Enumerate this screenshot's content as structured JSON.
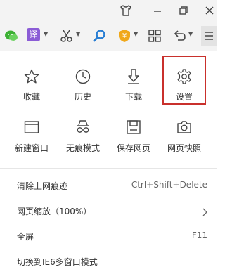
{
  "window": {
    "title_icons": [
      "tshirt-icon",
      "minimize-icon",
      "restore-icon",
      "close-icon"
    ]
  },
  "toolbar": {
    "translate_label": "译",
    "icons": [
      "wechat-icon",
      "translate-icon",
      "scissors-icon",
      "search-icon",
      "shield-coin-icon",
      "apps-grid-icon",
      "undo-icon",
      "menu-icon"
    ]
  },
  "grid": {
    "row1": [
      {
        "label": "收藏",
        "icon": "star-icon"
      },
      {
        "label": "历史",
        "icon": "clock-icon"
      },
      {
        "label": "下载",
        "icon": "download-icon"
      },
      {
        "label": "设置",
        "icon": "gear-icon"
      }
    ],
    "row2": [
      {
        "label": "新建窗口",
        "icon": "new-window-icon"
      },
      {
        "label": "无痕模式",
        "icon": "incognito-icon"
      },
      {
        "label": "保存网页",
        "icon": "save-icon"
      },
      {
        "label": "网页快照",
        "icon": "camera-icon"
      }
    ]
  },
  "list": [
    {
      "label": "清除上网痕迹",
      "shortcut": "Ctrl+Shift+Delete"
    },
    {
      "label": "网页缩放（100%）",
      "shortcut": ""
    },
    {
      "label": "全屏",
      "shortcut": "F11"
    },
    {
      "label": "切换到IE6多窗口模式",
      "shortcut": ""
    }
  ],
  "colors": {
    "highlight": "#c9302c",
    "wechat": "#3cb034",
    "translate": "#8b5cd6",
    "search": "#2a7fd4",
    "shield": "#f0a81a"
  }
}
